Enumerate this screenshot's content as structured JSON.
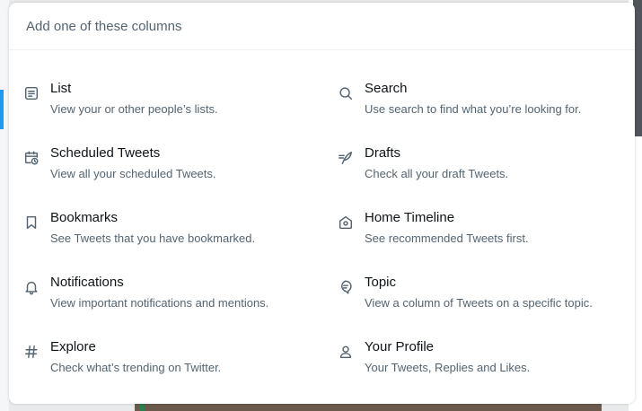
{
  "modal": {
    "title": "Add one of these columns",
    "columns": [
      {
        "icon": "list-icon",
        "label": "List",
        "description": "View your or other people’s lists."
      },
      {
        "icon": "search-icon",
        "label": "Search",
        "description": "Use search to find what you’re looking for."
      },
      {
        "icon": "calendar-clock-icon",
        "label": "Scheduled Tweets",
        "description": "View all your scheduled Tweets."
      },
      {
        "icon": "feather-icon",
        "label": "Drafts",
        "description": "Check all your draft Tweets."
      },
      {
        "icon": "bookmark-icon",
        "label": "Bookmarks",
        "description": "See Tweets that you have bookmarked."
      },
      {
        "icon": "home-icon",
        "label": "Home Timeline",
        "description": "See recommended Tweets first."
      },
      {
        "icon": "bell-icon",
        "label": "Notifications",
        "description": "View important notifications and mentions."
      },
      {
        "icon": "topic-icon",
        "label": "Topic",
        "description": "View a column of Tweets on a specific topic."
      },
      {
        "icon": "hashtag-icon",
        "label": "Explore",
        "description": "Check what’s trending on Twitter."
      },
      {
        "icon": "person-icon",
        "label": "Your Profile",
        "description": "Your Tweets, Replies and Likes."
      }
    ]
  },
  "colors": {
    "accent": "#1d9bf0",
    "text_primary": "#0f1419",
    "text_secondary": "#536471"
  }
}
